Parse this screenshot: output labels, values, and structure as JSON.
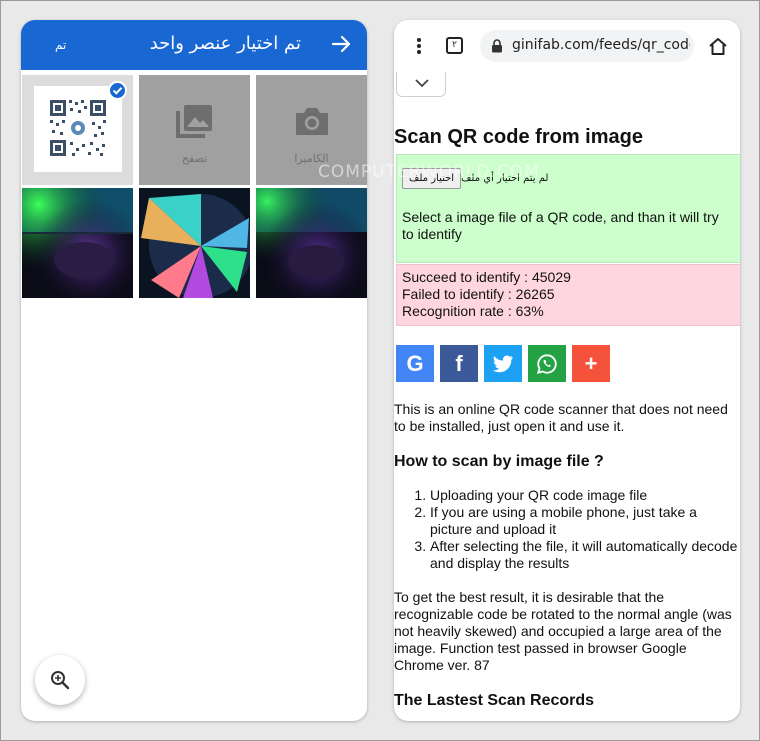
{
  "left": {
    "title": "تم اختيار عنصر واحد",
    "done_label": "تم",
    "tiles": {
      "camera_label": "الكاميرا",
      "browse_label": "تصفح"
    }
  },
  "right": {
    "tab_count": "٢",
    "url": "ginifab.com/feeds/qr_code/",
    "page_title": "Scan QR code from image",
    "file_button": "اختيار ملف",
    "file_status": "لم يتم اختيار أي ملف",
    "upload_desc": "Select a image file of a QR code, and than it will try to identify",
    "stats": {
      "succeed": "Succeed to identify : 45029",
      "failed": "Failed to identify : 26265",
      "rate": "Recognition rate : 63%"
    },
    "share": {
      "google": "G",
      "facebook": "f",
      "plus": "+"
    },
    "intro": "This is an online QR code scanner that does not need to be installed, just open it and use it.",
    "howto_heading": "How to scan by image file ?",
    "steps": [
      "Uploading your QR code image file",
      "If you are using a mobile phone, just take a picture and upload it",
      "After selecting the file, it will automatically decode and display the results"
    ],
    "tip": "To get the best result, it is desirable that the recognizable code be rotated to the normal angle (was not heavily skewed) and occupied a large area of the image. Function test passed in browser Google Chrome ver. 87",
    "records_heading": "The Lastest Scan Records"
  },
  "watermark": "COMPUTERWORLD.COM",
  "colors": {
    "picker_blue": "#1967d2",
    "upload_green": "#ccffcc",
    "stats_pink": "#ffd6e0",
    "google": "#4285f4",
    "facebook": "#3b5998",
    "twitter": "#1da1f2",
    "whatsapp": "#25a244",
    "plus": "#f4523b"
  }
}
